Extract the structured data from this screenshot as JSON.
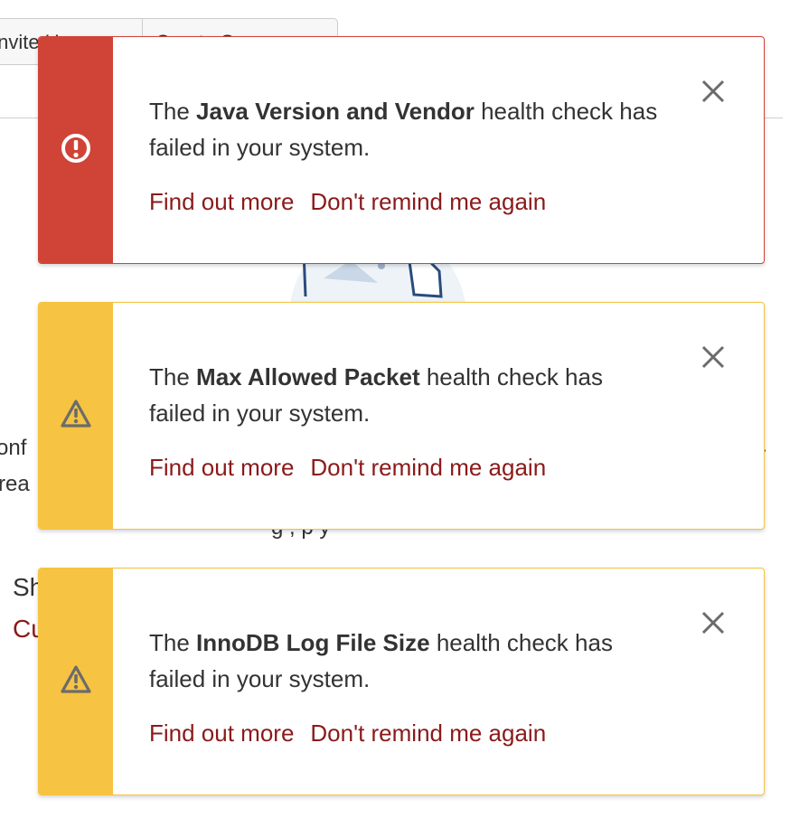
{
  "background": {
    "buttons": [
      "Invite Users",
      "Create Space"
    ],
    "line1_fragment": "onf",
    "line2_fragment": "rea",
    "line3_fragment": "g   ,   p  y",
    "heading_fragment": "Sh",
    "link_fragment": "Cu"
  },
  "notifications": [
    {
      "type": "error",
      "icon": "error-circle-icon",
      "color": "#d04437",
      "prefix": "The ",
      "name": "Java Version and Vendor",
      "suffix": " health check has failed in your system.",
      "find_out_more": "Find out more",
      "dont_remind": "Don't remind me again"
    },
    {
      "type": "warning",
      "icon": "warning-triangle-icon",
      "color": "#f6c342",
      "prefix": "The ",
      "name": "Max Allowed Packet",
      "suffix": " health check has failed in your system.",
      "find_out_more": "Find out more",
      "dont_remind": "Don't remind me again"
    },
    {
      "type": "warning",
      "icon": "warning-triangle-icon",
      "color": "#f6c342",
      "prefix": "The ",
      "name": "InnoDB Log File Size",
      "suffix": " health check has failed in your system.",
      "find_out_more": "Find out more",
      "dont_remind": "Don't remind me again"
    }
  ]
}
